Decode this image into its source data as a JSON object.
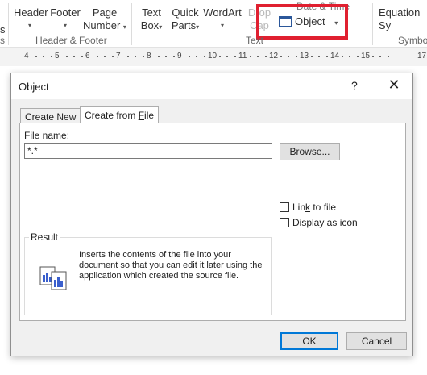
{
  "ribbon": {
    "header": {
      "label": "Header",
      "caret": "▾"
    },
    "footer": {
      "label": "Footer",
      "caret": "▾"
    },
    "page_number": {
      "line1": "Page",
      "line2": "Number",
      "caret": "▾"
    },
    "header_footer_group": "Header & Footer",
    "text_box": {
      "line1": "Text",
      "line2": "Box",
      "caret": "▾"
    },
    "quick_parts": {
      "line1": "Quick",
      "line2": "Parts",
      "caret": "▾"
    },
    "wordart": {
      "label": "WordArt",
      "caret": "▾"
    },
    "drop_cap": {
      "line1": "Drop",
      "line2": "Cap"
    },
    "date_time": "Date & Time",
    "object": {
      "label": "Object",
      "caret": "▾"
    },
    "text_group": "Text",
    "equation": "Equation",
    "symbols_group": "Symbo",
    "sy_partial": "Sy",
    "left_partial": "s"
  },
  "ruler": {
    "numbers": [
      "4",
      "5",
      "6",
      "7",
      "8",
      "9",
      "10",
      "11",
      "12",
      "13",
      "14",
      "15",
      "17"
    ]
  },
  "dialog": {
    "title": "Object",
    "help": "?",
    "close": "✕",
    "tabs": {
      "create_new": "Create New",
      "create_from_file_prefix": "Create from ",
      "create_from_file_underlined": "F",
      "create_from_file_suffix": "ile"
    },
    "file_name_label": "File name:",
    "file_name_value": "*.*",
    "browse": {
      "underlined": "B",
      "rest": "rowse..."
    },
    "link_to_file": {
      "prefix": "Lin",
      "underlined": "k",
      "suffix": " to file"
    },
    "display_as_icon": {
      "prefix": "Display as ",
      "underlined": "i",
      "suffix": "con"
    },
    "result_label": "Result",
    "result_text": "Inserts the contents of the file into your document so that you can edit it later using the application which created the source file.",
    "ok": "OK",
    "cancel": "Cancel"
  }
}
